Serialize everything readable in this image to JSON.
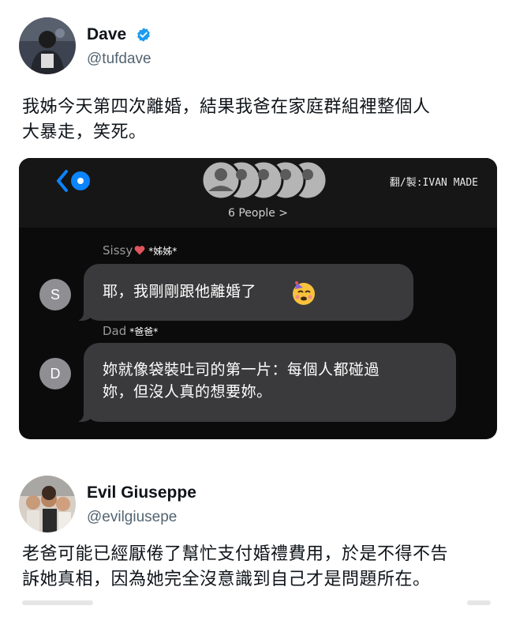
{
  "posts": [
    {
      "name": "Dave",
      "handle": "@tufdave",
      "verified": true,
      "text_lines": [
        "我姊今天第四次離婚，結果我爸在家庭群組裡整個人",
        "大暴走，笑死。"
      ]
    },
    {
      "name": "Evil Giuseppe",
      "handle": "@evilgiusepe",
      "text_lines": [
        "老爸可能已經厭倦了幫忙支付婚禮費用，於是不得不告",
        "訴她真相，因為她完全沒意識到自己才是問題所在。"
      ]
    }
  ],
  "screenshot": {
    "credit": "翻/製:IVAN MADE",
    "people_label": "6 People >",
    "messages": [
      {
        "sender": "Sissy",
        "sender_note": "*姊姊*",
        "initial": "S",
        "lines": [
          "耶，我剛剛跟他離婚了"
        ],
        "emoji": "partying-face-icon"
      },
      {
        "sender": "Dad",
        "sender_note": "*爸爸*",
        "initial": "D",
        "lines": [
          "妳就像袋裝吐司的第一片：每個人都碰過",
          "妳，但沒人真的想要妳。"
        ]
      }
    ]
  },
  "colors": {
    "verified": "#1d9bf0",
    "imessage_blue": "#0a84ff",
    "bubble": "#3a3a3c"
  }
}
